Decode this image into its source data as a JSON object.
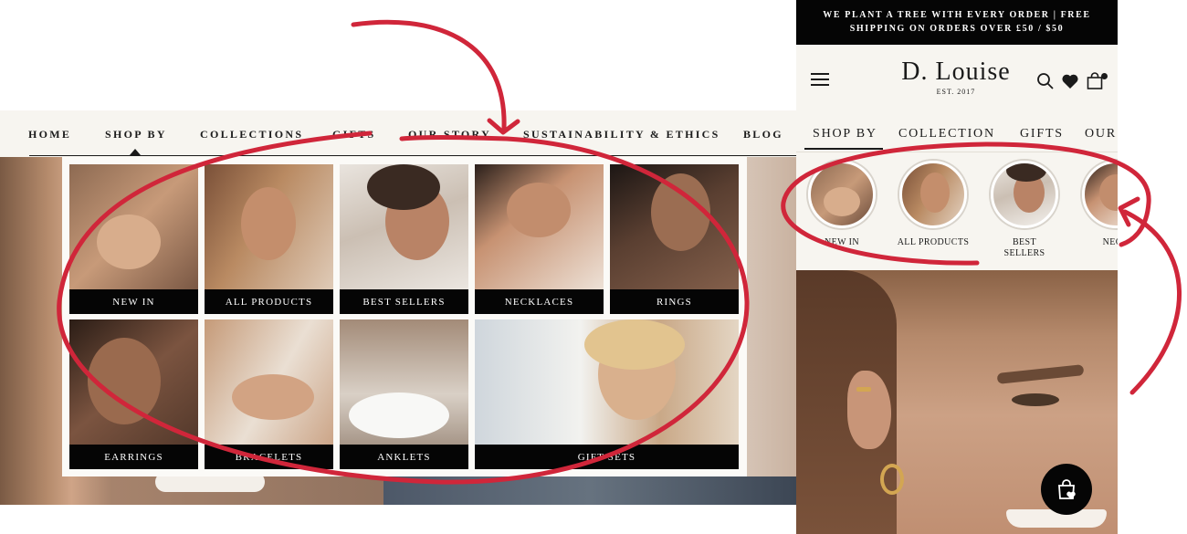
{
  "desktop": {
    "nav": {
      "items": [
        "HOME",
        "SHOP BY",
        "COLLECTIONS",
        "GIFTS",
        "OUR STORY",
        "SUSTAINABILITY & ETHICS",
        "BLOG"
      ],
      "active": "SHOP BY"
    },
    "mega_menu": {
      "tiles": [
        {
          "label": "NEW IN"
        },
        {
          "label": "ALL PRODUCTS"
        },
        {
          "label": "BEST SELLERS"
        },
        {
          "label": "NECKLACES"
        },
        {
          "label": "RINGS"
        },
        {
          "label": "EARRINGS"
        },
        {
          "label": "BRACELETS"
        },
        {
          "label": "ANKLETS"
        },
        {
          "label": "GIFT SETS"
        }
      ]
    }
  },
  "mobile": {
    "banner": {
      "line1": "WE PLANT A TREE WITH EVERY ORDER | FREE",
      "line2": "SHIPPING ON ORDERS OVER £50 / $50"
    },
    "logo": {
      "name": "D. Louise",
      "est": "EST. 2017"
    },
    "icons": [
      "menu-icon",
      "search-icon",
      "heart-icon",
      "bag-icon",
      "shop-bag-heart-icon"
    ],
    "tabs": [
      "SHOP BY",
      "COLLECTION",
      "GIFTS",
      "OUR"
    ],
    "active_tab": "SHOP BY",
    "circles": [
      {
        "label": "NEW IN"
      },
      {
        "label": "ALL PRODUCTS"
      },
      {
        "label": "BEST SELLERS"
      },
      {
        "label": "NECK"
      }
    ]
  },
  "colors": {
    "nav_bg": "#f7f5f0",
    "label_bar": "#050505",
    "annotation": "#d0263a",
    "text": "#1a1a1a"
  }
}
